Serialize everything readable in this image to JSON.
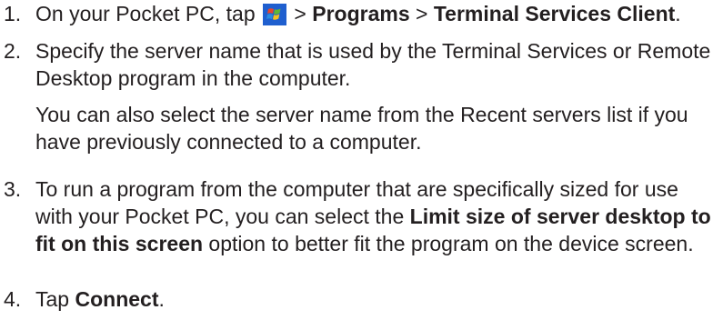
{
  "steps": [
    {
      "number": "1.",
      "text_before_icon": "On your Pocket PC, tap ",
      "icon": "windows-start-icon",
      "sep1": " > ",
      "bold1": "Programs",
      "sep2": " > ",
      "bold2": "Terminal Services Client",
      "end": "."
    },
    {
      "number": "2.",
      "text": "Specify the server name that is used by the Terminal Services or Remote Desktop program in the computer.",
      "text2": "You can also select the server name from the Recent servers list if you have previously connected to a computer."
    },
    {
      "number": "3.",
      "text_before": "To run a program from the computer that are specifically sized for use with your Pocket PC, you can select the ",
      "bold": "Limit size of server desktop to fit on this screen",
      "text_after": " option to better fit the program on the device screen."
    },
    {
      "number": "4.",
      "text_before": "Tap ",
      "bold": "Connect",
      "end": "."
    }
  ],
  "colors": {
    "text": "#231f20",
    "icon_background": "#1f5fcf"
  }
}
